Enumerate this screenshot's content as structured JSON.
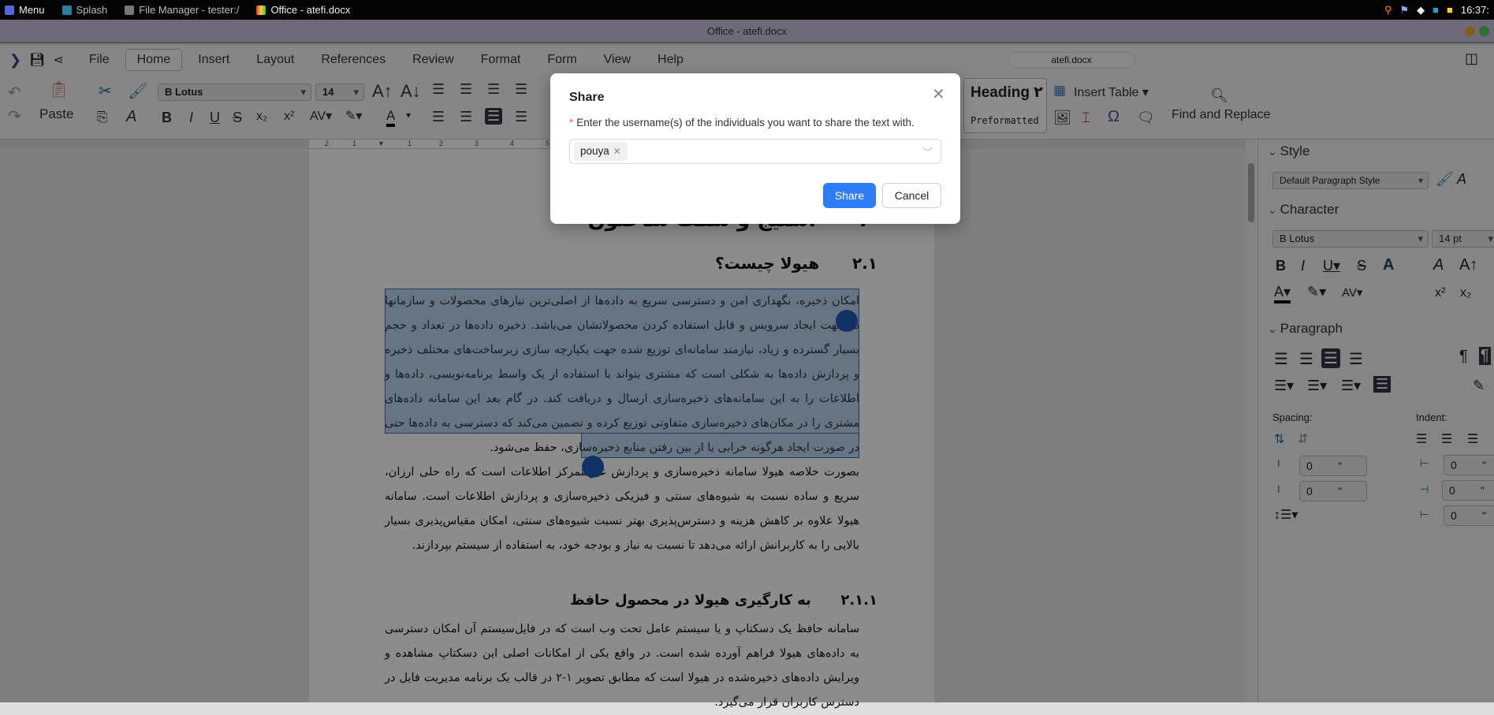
{
  "taskbar": {
    "menu": "Menu",
    "items": [
      "Splash",
      "File Manager - tester:/",
      "Office - atefi.docx"
    ],
    "clock": "16:37:"
  },
  "window": {
    "title": "Office - atefi.docx",
    "doc_name": "atefi.docx"
  },
  "menu": [
    "File",
    "Home",
    "Insert",
    "Layout",
    "References",
    "Review",
    "Format",
    "Form",
    "View",
    "Help"
  ],
  "toolbar": {
    "paste": "Paste",
    "font": "B Lotus",
    "size": "14",
    "heading": "Heading ۲",
    "preformatted": "Preformatted",
    "insert_table": "Insert Table",
    "find_replace": "Find and Replace",
    "bold": "B",
    "italic": "I",
    "underline": "U",
    "strike": "S"
  },
  "ruler": [
    "2",
    "1",
    "1",
    "2",
    "3",
    "4",
    "5"
  ],
  "document": {
    "heading_top": "۲      استیج و سکت ساختون",
    "h1": "۲.۱      هیولا چیست؟",
    "p1": "امکان ذخیره، نگهداری امن و دسترسی سریع به داده‌ها از اصلی‌ترین نیازهای محصولات و سازمانها در جهت ایجاد سرویس و قابل استفاده کردن محصولاتشان می‌باشد. ذخیره داده‌ها در تعداد و حجم بسیار گسترده و زیاد، نیازمند سامانه‌ای توزیع شده جهت یکپارچه سازی زیرساخت‌های مختلف ذخیره و پردازش داده‌ها به شکلی است که مشتری بتواند با استفاده از یک واسط برنامه‌نویسی، داده‌ها و اطلاعات را به این سامانه‌های ذخیره‌سازی ارسال و دریافت کند. در گام بعد این سامانه داده‌های مشتری را در مکان‌های ذخیره‌سازی متفاوتی توزیع کرده و تضمین می‌کند که دسترسی به داده‌ها حتی در صورت ایجاد هرگونه خرابی یا از بین رفتن منابع ذخیره‌سازی، حفظ می‌شود.",
    "p2": "بصورت خلاصه هیولا سامانه ذخیره‌سازی و پردازش غیرمتمرکز اطلاعات است که راه حلی ارزان، سریع و ساده نسبت به شیوه‌های سنتی و فیزیکی ذخیره‌سازی و پردازش اطلاعات است. سامانه هیولا علاوه بر کاهش هزینه و دسترس‌پذیری بهتر نسبت شیوه‌های سنتی، امکان مقیاس‌پذیری بسیار بالایی را به کاربرانش ارائه می‌دهد تا نسبت به نیاز و بودجه خود، به استفاده از سیستم بپردازند.",
    "h2": "۲.۱.۱      به کارگیری هیولا در محصول حافظ",
    "p3": "سامانه حافظ یک دسکتاپ و یا سیستم عامل تحت وب است که در فایل‌سیستم آن امکان دسترسی به داده‌های هیولا فراهم آورده شده است. در واقع یکی از امکانات اصلی این دسکتاپ مشاهده و ویرایش داده‌های ذخیره‌شده در هیولا است که مطابق تصویر ۱-۲ در قالب یک برنامه مدیریت فایل در دسترس کاربران قرار می‌گیرد."
  },
  "sidebar": {
    "style": "Style",
    "paragraph_style": "Default Paragraph Style",
    "character": "Character",
    "font": "B Lotus",
    "size": "14 pt",
    "paragraph": "Paragraph",
    "spacing": "Spacing:",
    "indent": "Indent:",
    "spin_value": "0",
    "unit": "\""
  },
  "dialog": {
    "title": "Share",
    "label": "Enter the username(s) of the individuals you want to share the text with.",
    "tags": [
      "pouya"
    ],
    "share": "Share",
    "cancel": "Cancel"
  },
  "colors": {
    "accent": "#2f7df6",
    "selection": "#4682c8"
  }
}
